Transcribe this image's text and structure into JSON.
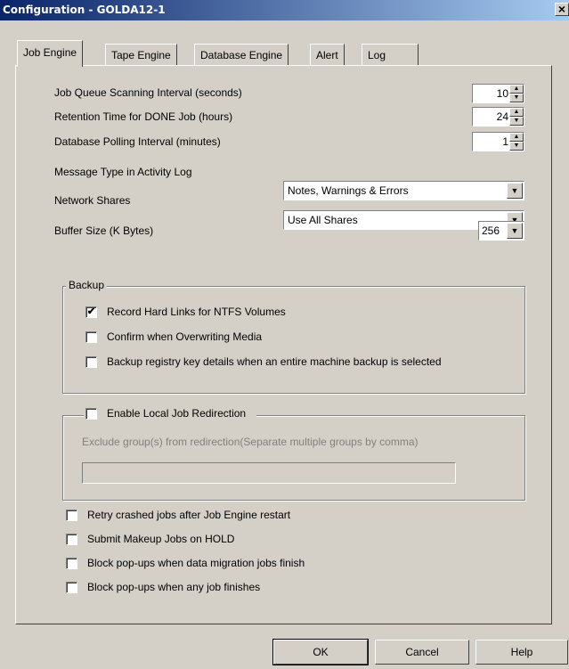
{
  "window": {
    "title": "Configuration - GOLDA12-1",
    "close_glyph": "×"
  },
  "tabs": [
    {
      "label": "Job Engine",
      "active": true
    },
    {
      "label": "Tape Engine",
      "active": false
    },
    {
      "label": "Database Engine",
      "active": false
    },
    {
      "label": "Alert",
      "active": false
    },
    {
      "label": "Log",
      "active": false
    }
  ],
  "fields": {
    "job_queue": {
      "label": "Job Queue Scanning Interval (seconds)",
      "value": "10"
    },
    "retention": {
      "label": "Retention Time for DONE Job (hours)",
      "value": "24"
    },
    "db_polling": {
      "label": "Database Polling Interval (minutes)",
      "value": "1"
    },
    "message_type": {
      "label": "Message Type in Activity Log",
      "value": "Notes, Warnings & Errors"
    },
    "network_shares": {
      "label": "Network Shares",
      "value": "Use All Shares"
    },
    "buffer_size": {
      "label": "Buffer Size (K Bytes)",
      "value": "256"
    }
  },
  "backup_group": {
    "title": "Backup",
    "options": [
      {
        "label": "Record Hard Links for NTFS Volumes",
        "checked": true
      },
      {
        "label": "Confirm when Overwriting Media",
        "checked": false
      },
      {
        "label": "Backup registry key details when an entire machine backup is selected",
        "checked": false
      }
    ]
  },
  "redirection_group": {
    "title": "Enable Local Job Redirection",
    "checked": false,
    "exclude_label": "Exclude group(s) from redirection(Separate multiple groups by comma)",
    "exclude_value": ""
  },
  "options": [
    {
      "label": "Retry crashed jobs after Job Engine restart",
      "checked": false
    },
    {
      "label": "Submit Makeup Jobs on HOLD",
      "checked": false
    },
    {
      "label": "Block pop-ups when data migration jobs finish",
      "checked": false
    },
    {
      "label": "Block pop-ups when any job finishes",
      "checked": false
    }
  ],
  "buttons": {
    "ok": "OK",
    "cancel": "Cancel",
    "help": "Help"
  },
  "glyphs": {
    "check": "✔",
    "spin_up": "▲",
    "spin_down": "▼",
    "combo_arrow": "▼"
  }
}
